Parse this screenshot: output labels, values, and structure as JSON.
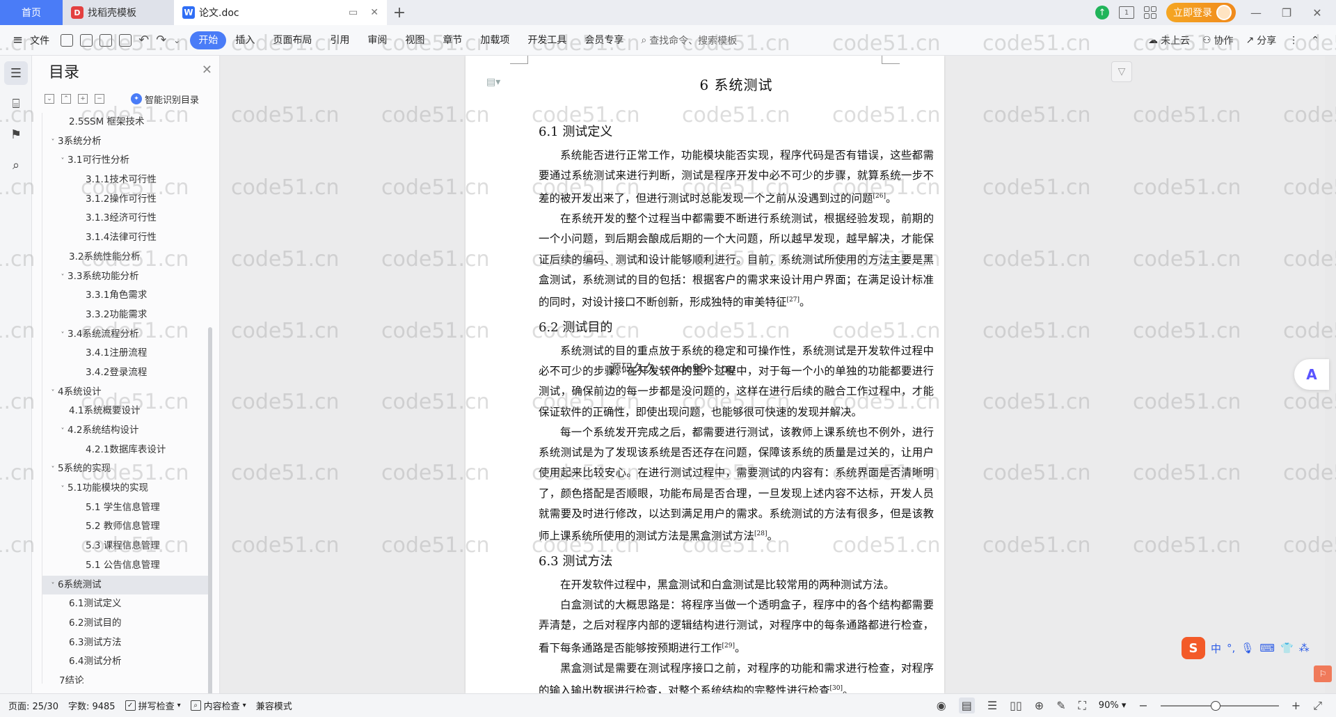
{
  "titlebar": {
    "tabs": [
      {
        "label": "首页"
      },
      {
        "label": "找稻壳模板",
        "icon": "docer-logo-icon"
      },
      {
        "label": "论文.doc",
        "icon": "wps-writer-logo-icon"
      }
    ],
    "login_label": "立即登录"
  },
  "ribbon": {
    "file_label": "文件",
    "menu": [
      "开始",
      "插入",
      "页面布局",
      "引用",
      "审阅",
      "视图",
      "章节",
      "加载项",
      "开发工具",
      "会员专享"
    ],
    "active_menu": "开始",
    "search_placeholder": "查找命令、搜索模板",
    "right": [
      "未上云",
      "协作",
      "分享"
    ]
  },
  "toc": {
    "title": "目录",
    "smart_label": "智能识别目录",
    "items": [
      {
        "label": "2.5SSM 框架技术",
        "level": 2,
        "chevron": ""
      },
      {
        "label": "3系统分析",
        "level": 1,
        "chevron": "˅"
      },
      {
        "label": "3.1可行性分析",
        "level": 2,
        "chevron": "˅"
      },
      {
        "label": "3.1.1技术可行性",
        "level": 3,
        "chevron": ""
      },
      {
        "label": "3.1.2操作可行性",
        "level": 3,
        "chevron": ""
      },
      {
        "label": "3.1.3经济可行性",
        "level": 3,
        "chevron": ""
      },
      {
        "label": "3.1.4法律可行性",
        "level": 3,
        "chevron": ""
      },
      {
        "label": "3.2系统性能分析",
        "level": 2,
        "chevron": ""
      },
      {
        "label": "3.3系统功能分析",
        "level": 2,
        "chevron": "˅"
      },
      {
        "label": "3.3.1角色需求",
        "level": 3,
        "chevron": ""
      },
      {
        "label": "3.3.2功能需求",
        "level": 3,
        "chevron": ""
      },
      {
        "label": "3.4系统流程分析",
        "level": 2,
        "chevron": "˅"
      },
      {
        "label": "3.4.1注册流程",
        "level": 3,
        "chevron": ""
      },
      {
        "label": "3.4.2登录流程",
        "level": 3,
        "chevron": ""
      },
      {
        "label": "4系统设计",
        "level": 1,
        "chevron": "˅"
      },
      {
        "label": "4.1系统概要设计",
        "level": 2,
        "chevron": ""
      },
      {
        "label": "4.2系统结构设计",
        "level": 2,
        "chevron": "˅"
      },
      {
        "label": "4.2.1数据库表设计",
        "level": 3,
        "chevron": ""
      },
      {
        "label": "5系统的实现",
        "level": 1,
        "chevron": "˅"
      },
      {
        "label": "5.1功能模块的实现",
        "level": 2,
        "chevron": "˅"
      },
      {
        "label": "5.1 学生信息管理",
        "level": 3,
        "chevron": ""
      },
      {
        "label": "5.2  教师信息管理",
        "level": 3,
        "chevron": ""
      },
      {
        "label": "5.3 课程信息管理",
        "level": 3,
        "chevron": ""
      },
      {
        "label": "5.1 公告信息管理",
        "level": 3,
        "chevron": ""
      },
      {
        "label": "6系统测试",
        "level": 1,
        "chevron": "˅",
        "selected": true
      },
      {
        "label": "6.1测试定义",
        "level": 2,
        "chevron": ""
      },
      {
        "label": "6.2测试目的",
        "level": 2,
        "chevron": ""
      },
      {
        "label": "6.3测试方法",
        "level": 2,
        "chevron": ""
      },
      {
        "label": "6.4测试分析",
        "level": 2,
        "chevron": ""
      },
      {
        "label": "7结论",
        "level": 1,
        "chevron": ""
      }
    ]
  },
  "document": {
    "chapter_title": "6  系统测试",
    "sections": [
      {
        "heading": "6.1  测试定义",
        "paragraphs": [
          {
            "text": "系统能否进行正常工作，功能模块能否实现，程序代码是否有错误，这些都需要通过系统测试来进行判断，测试是程序开发中必不可少的步骤，就算系统一步不差的被开发出来了，但进行测试时总能发现一个之前从没遇到过的问题",
            "ref": "[26]",
            "tail": "。"
          },
          {
            "text": "在系统开发的整个过程当中都需要不断进行系统测试，根据经验发现，前期的一个小问题，到后期会酿成后期的一个大问题，所以越早发现，越早解决，才能保证后续的编码、测试和设计能够顺利进行。目前，系统测试所使用的方法主要是黑盒测试，系统测试的目的包括：根据客户的需求来设计用户界面；在满足设计标准的同时，对设计接口不断创新，形成独特的审美特征",
            "ref": "[27]",
            "tail": "。"
          }
        ]
      },
      {
        "heading": "6.2  测试目的",
        "paragraphs": [
          {
            "text": "系统测试的目的重点放于系统的稳定和可操作性，系统测试是开发软件过程中必不可少的步骤。在开发软件的整个过程中，对于每一个小的单独的功能都要进行测试，确保前边的每一步都是没问题的，这样在进行后续的融合工作过程中，才能保证软件的正确性，即使出现问题，也能够很可快速的发现并解决。",
            "ref": "",
            "tail": ""
          },
          {
            "text": "每一个系统发开完成之后，都需要进行测试，该教师上课系统也不例外，进行系统测试是为了发现该系统是否还存在问题，保障该系统的质量是过关的，让用户使用起来比较安心。在进行测试过程中，需要测试的内容有：系统界面是否清晰明了，颜色搭配是否顺眼，功能布局是否合理，一旦发现上述内容不达标，开发人员就需要及时进行修改，以达到满足用户的需求。系统测试的方法有很多，但是该教师上课系统所使用的测试方法是黑盒测试方法",
            "ref": "[28]",
            "tail": "。"
          }
        ]
      },
      {
        "heading": "6.3  测试方法",
        "paragraphs": [
          {
            "text": "在开发软件过程中，黑盒测试和白盒测试是比较常用的两种测试方法。",
            "ref": "",
            "tail": ""
          },
          {
            "text": "白盒测试的大概思路是：将程序当做一个透明盒子，程序中的各个结构都需要弄清楚，之后对程序内部的逻辑结构进行测试，对程序中的每条通路都进行检查，看下每条通路是否能够按预期进行工作",
            "ref": "[29]",
            "tail": "。"
          },
          {
            "text": "黑盒测试是需要在测试程序接口之前，对程序的功能和需求进行检查，对程序的输入输出数据进行检查，对整个系统结构的完整性进行检查",
            "ref": "[30]",
            "tail": "。"
          }
        ]
      }
    ]
  },
  "watermark": {
    "text": "code51.cn",
    "center_text": "源码久久-code99.top"
  },
  "ime": {
    "lang": "中"
  },
  "statusbar": {
    "page": "页面: 25/30",
    "words": "字数: 9485",
    "spell": "拼写检查",
    "content_check": "内容检查",
    "compat": "兼容模式",
    "zoom": "90%"
  }
}
